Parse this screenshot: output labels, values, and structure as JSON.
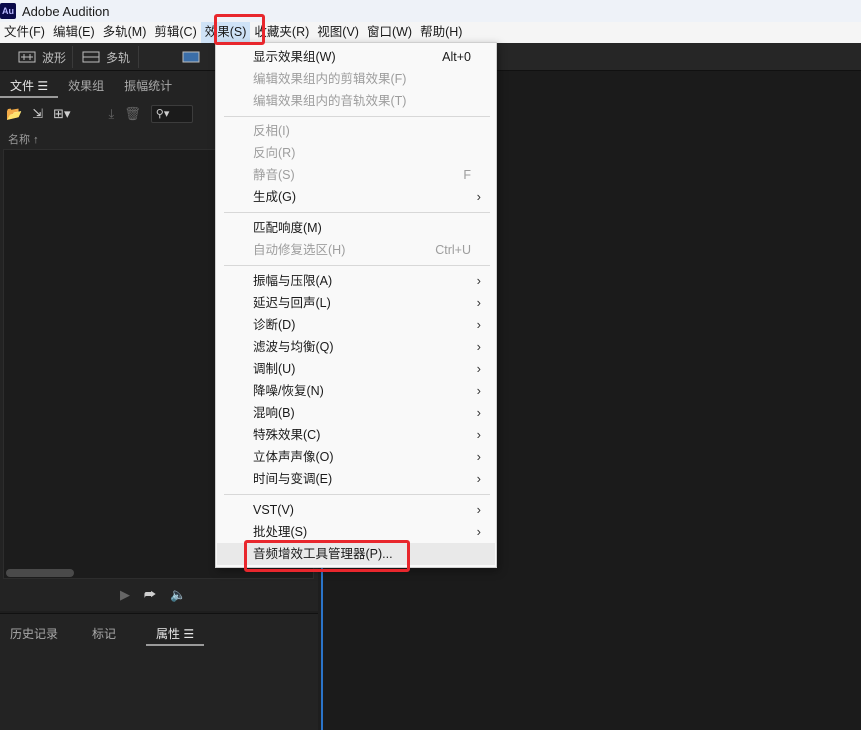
{
  "app": {
    "logo_text": "Au",
    "title": "Adobe Audition"
  },
  "menubar": [
    "文件(F)",
    "编辑(E)",
    "多轨(M)",
    "剪辑(C)",
    "效果(S)",
    "收藏夹(R)",
    "视图(V)",
    "窗口(W)",
    "帮助(H)"
  ],
  "toolbar": {
    "waveform_label": "波形",
    "multitrack_label": "多轨"
  },
  "left_panel": {
    "tabs": {
      "files": "文件",
      "effects_group": "效果组",
      "amplitude_stats": "振幅统计"
    },
    "column_name": "名称",
    "search_placeholder": "⚲▾"
  },
  "bottom_panel": {
    "tabs": {
      "history": "历史记录",
      "markers": "标记",
      "properties": "属性"
    }
  },
  "dropdown": {
    "items": [
      {
        "label": "显示效果组(W)",
        "shortcut": "Alt+0"
      },
      {
        "label": "编辑效果组内的剪辑效果(F)"
      },
      {
        "label": "编辑效果组内的音轨效果(T)"
      },
      {
        "label": "反相(I)"
      },
      {
        "label": "反向(R)"
      },
      {
        "label": "静音(S)",
        "shortcut": "F"
      },
      {
        "label": "生成(G)"
      },
      {
        "label": "匹配响度(M)"
      },
      {
        "label": "自动修复选区(H)",
        "shortcut": "Ctrl+U"
      },
      {
        "label": "振幅与压限(A)"
      },
      {
        "label": "延迟与回声(L)"
      },
      {
        "label": "诊断(D)"
      },
      {
        "label": "滤波与均衡(Q)"
      },
      {
        "label": "调制(U)"
      },
      {
        "label": "降噪/恢复(N)"
      },
      {
        "label": "混响(B)"
      },
      {
        "label": "特殊效果(C)"
      },
      {
        "label": "立体声声像(O)"
      },
      {
        "label": "时间与变调(E)"
      },
      {
        "label": "VST(V)"
      },
      {
        "label": "批处理(S)"
      },
      {
        "label": "音频增效工具管理器(P)..."
      }
    ]
  },
  "colors": {
    "highlight_box": "#e8272d",
    "panel_accent": "#2b74c9"
  }
}
